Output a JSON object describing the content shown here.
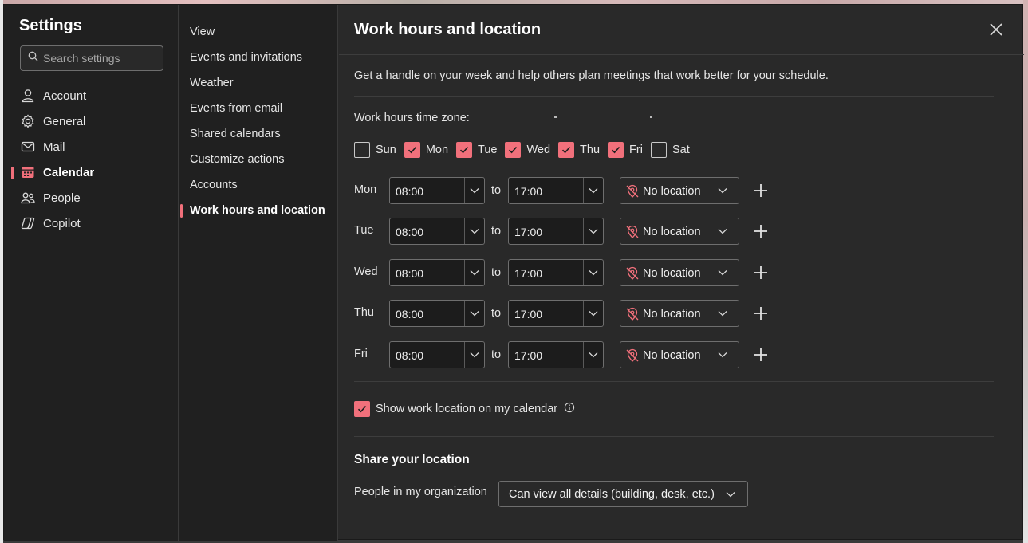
{
  "settings": {
    "title": "Settings",
    "search_placeholder": "Search settings",
    "nav": [
      {
        "label": "Account",
        "icon": "person-icon"
      },
      {
        "label": "General",
        "icon": "gear-icon"
      },
      {
        "label": "Mail",
        "icon": "mail-icon"
      },
      {
        "label": "Calendar",
        "icon": "calendar-icon",
        "active": true
      },
      {
        "label": "People",
        "icon": "people-icon"
      },
      {
        "label": "Copilot",
        "icon": "copilot-icon"
      }
    ]
  },
  "calendar_nav": {
    "items": [
      "View",
      "Events and invitations",
      "Weather",
      "Events from email",
      "Shared calendars",
      "Customize actions",
      "Accounts",
      "Work hours and location"
    ],
    "active": "Work hours and location"
  },
  "content": {
    "title": "Work hours and location",
    "description": "Get a handle on your week and help others plan meetings that work better for your schedule.",
    "timezone_label": "Work hours time zone:",
    "days": [
      {
        "label": "Sun",
        "checked": false
      },
      {
        "label": "Mon",
        "checked": true
      },
      {
        "label": "Tue",
        "checked": true
      },
      {
        "label": "Wed",
        "checked": true
      },
      {
        "label": "Thu",
        "checked": true
      },
      {
        "label": "Fri",
        "checked": true
      },
      {
        "label": "Sat",
        "checked": false
      }
    ],
    "to_label": "to",
    "schedule": [
      {
        "day": "Mon",
        "start": "08:00",
        "end": "17:00",
        "location": "No location"
      },
      {
        "day": "Tue",
        "start": "08:00",
        "end": "17:00",
        "location": "No location"
      },
      {
        "day": "Wed",
        "start": "08:00",
        "end": "17:00",
        "location": "No location"
      },
      {
        "day": "Thu",
        "start": "08:00",
        "end": "17:00",
        "location": "No location"
      },
      {
        "day": "Fri",
        "start": "08:00",
        "end": "17:00",
        "location": "No location"
      }
    ],
    "show_location_label": "Show work location on my calendar",
    "show_location_checked": true,
    "share_heading": "Share your location",
    "org_label": "People in my organization",
    "org_value": "Can view all details (building, desk, etc.)"
  },
  "colors": {
    "accent": "#f1707b",
    "panel_bg": "#292929",
    "nav_bg": "#202020",
    "text": "#e6e6e6"
  }
}
